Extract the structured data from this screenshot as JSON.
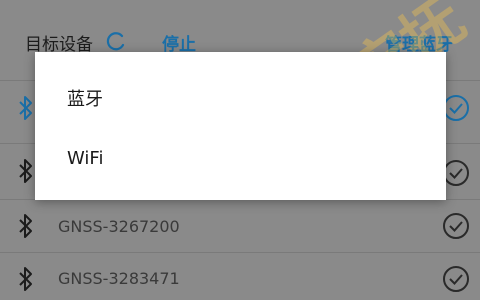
{
  "header": {
    "title": "目标设备",
    "stop_label": "停止",
    "manage_label": "管理蓝牙"
  },
  "watermark": "宏抚",
  "devices": [
    {
      "name": "",
      "selected": true
    },
    {
      "name": "",
      "selected": false
    },
    {
      "name": "GNSS-3267200",
      "selected": false
    },
    {
      "name": "GNSS-3283471",
      "selected": false
    }
  ],
  "menu": {
    "items": [
      "蓝牙",
      "WiFi"
    ]
  },
  "colors": {
    "accent": "#1a6fa8",
    "dim_overlay": "#8a8a8a",
    "watermark": "#ffc846"
  }
}
